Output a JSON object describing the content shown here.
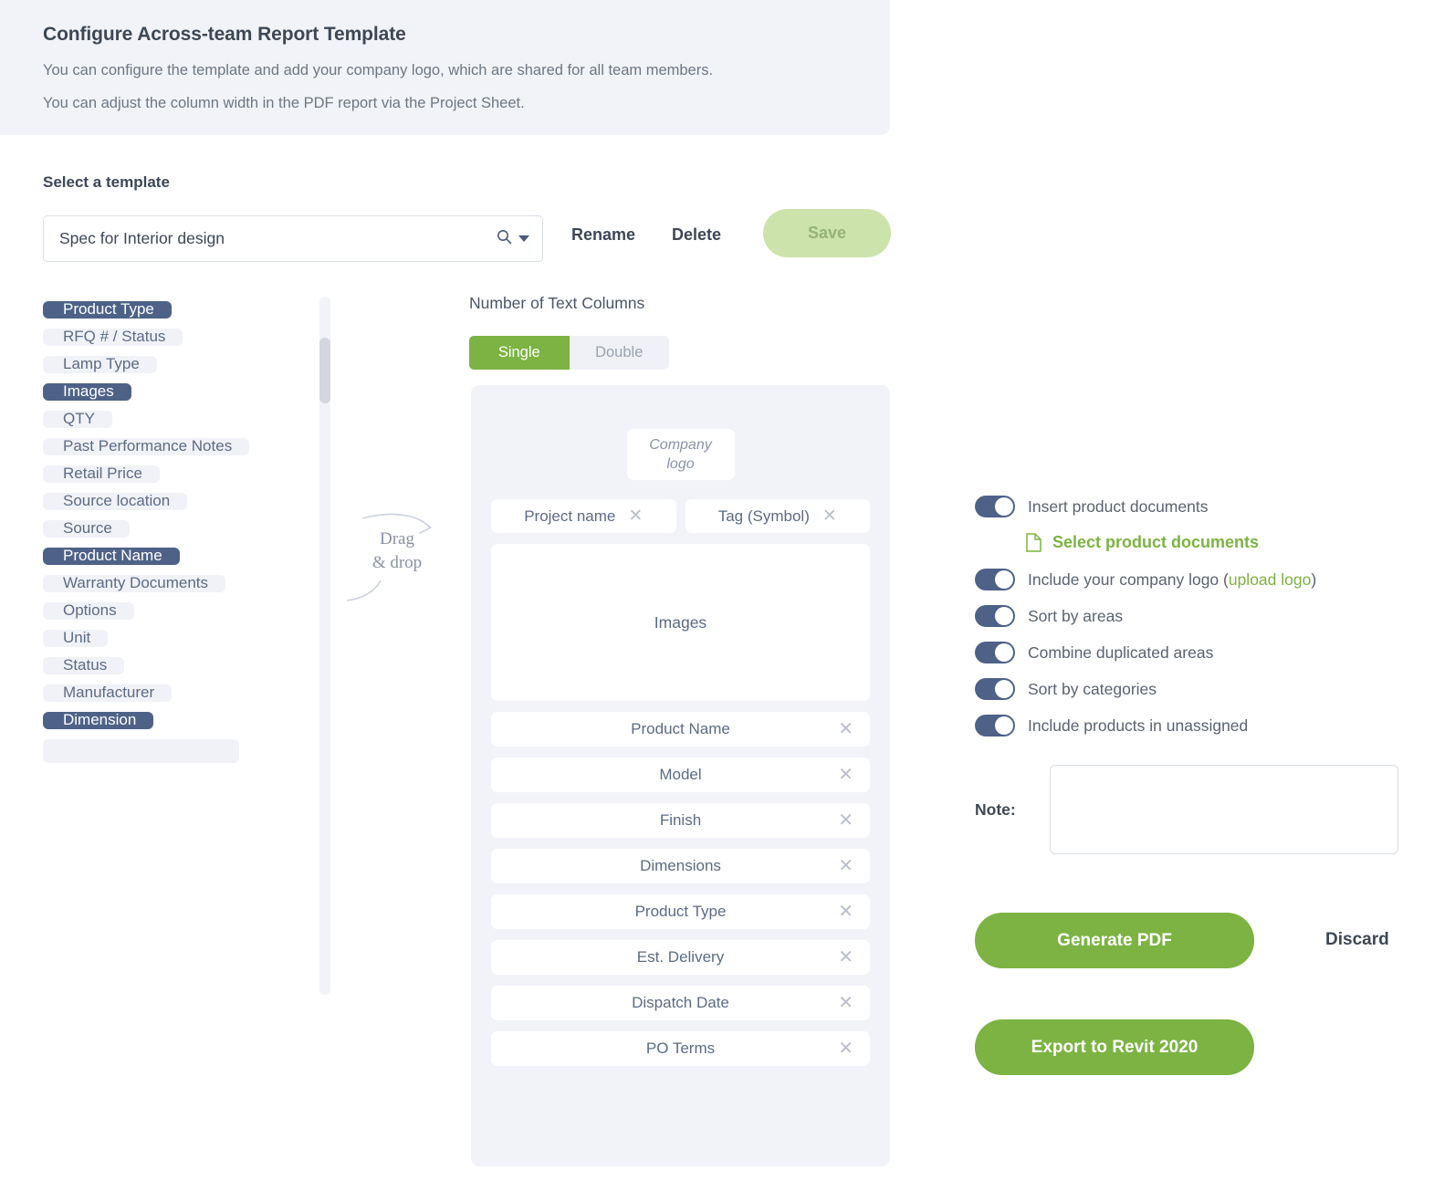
{
  "banner": {
    "title": "Configure Across-team Report Template",
    "line1": "You can configure the template and add your company logo, which are shared for all team members.",
    "line2": "You can adjust the column width in the PDF report via the Project Sheet."
  },
  "template": {
    "label": "Select a template",
    "value": "Spec for Interior design",
    "placeholder": "Spec for Interior design",
    "search_icon": "search-icon",
    "caret_icon": "chevron-down-icon",
    "rename_label": "Rename",
    "delete_label": "Delete",
    "save_label": "Save"
  },
  "field_chips": [
    {
      "label": "Product Type",
      "selected": true
    },
    {
      "label": "RFQ # / Status",
      "selected": false
    },
    {
      "label": "Lamp Type",
      "selected": false
    },
    {
      "label": "Images",
      "selected": true
    },
    {
      "label": "QTY",
      "selected": false
    },
    {
      "label": "Past Performance Notes",
      "selected": false
    },
    {
      "label": "Retail Price",
      "selected": false
    },
    {
      "label": "Source location",
      "selected": false
    },
    {
      "label": "Source",
      "selected": false
    },
    {
      "label": "Product Name",
      "selected": true
    },
    {
      "label": "Warranty Documents",
      "selected": false
    },
    {
      "label": "Options",
      "selected": false
    },
    {
      "label": "Unit",
      "selected": false
    },
    {
      "label": "Status",
      "selected": false
    },
    {
      "label": "Manufacturer",
      "selected": false
    },
    {
      "label": "Dimension",
      "selected": true
    },
    {
      "label": "",
      "selected": false
    }
  ],
  "dragdrop": {
    "line1": "Drag",
    "line2": "& drop"
  },
  "columns": {
    "label": "Number of Text Columns",
    "options": [
      {
        "label": "Single",
        "active": true
      },
      {
        "label": "Double",
        "active": false
      }
    ]
  },
  "preview": {
    "logo_placeholder_line1": "Company",
    "logo_placeholder_line2": "logo",
    "header_pills": [
      {
        "label": "Project name"
      },
      {
        "label": "Tag (Symbol)"
      }
    ],
    "images_label": "Images",
    "rows": [
      {
        "label": "Product Name"
      },
      {
        "label": "Model"
      },
      {
        "label": "Finish"
      },
      {
        "label": "Dimensions"
      },
      {
        "label": "Product Type"
      },
      {
        "label": "Est. Delivery"
      },
      {
        "label": "Dispatch Date"
      },
      {
        "label": "PO Terms"
      }
    ],
    "remove_icon": "close-icon"
  },
  "options": {
    "insert_product_documents": "Insert product documents",
    "select_product_documents": "Select product documents",
    "select_product_documents_icon": "document-icon",
    "include_company_logo_pre": "Include your company logo (",
    "include_company_logo_link": "upload logo",
    "include_company_logo_post": ")",
    "sort_by_areas": "Sort by areas",
    "combine_duplicated_areas": "Combine duplicated areas",
    "sort_by_categories": "Sort by categories",
    "include_products_unassigned": "Include products in unassigned"
  },
  "note": {
    "label": "Note:",
    "value": "",
    "placeholder": ""
  },
  "actions": {
    "generate_pdf": "Generate PDF",
    "discard": "Discard",
    "export_revit": "Export to Revit 2020"
  },
  "colors": {
    "accent_green": "#7cb342",
    "save_disabled_green": "#cde3ac",
    "chip_selected": "#4e6288",
    "chip_default_bg": "#f0f2f7",
    "panel_bg": "#f1f3f8",
    "text_dark": "#3d4756",
    "text_muted": "#5c6b85"
  }
}
